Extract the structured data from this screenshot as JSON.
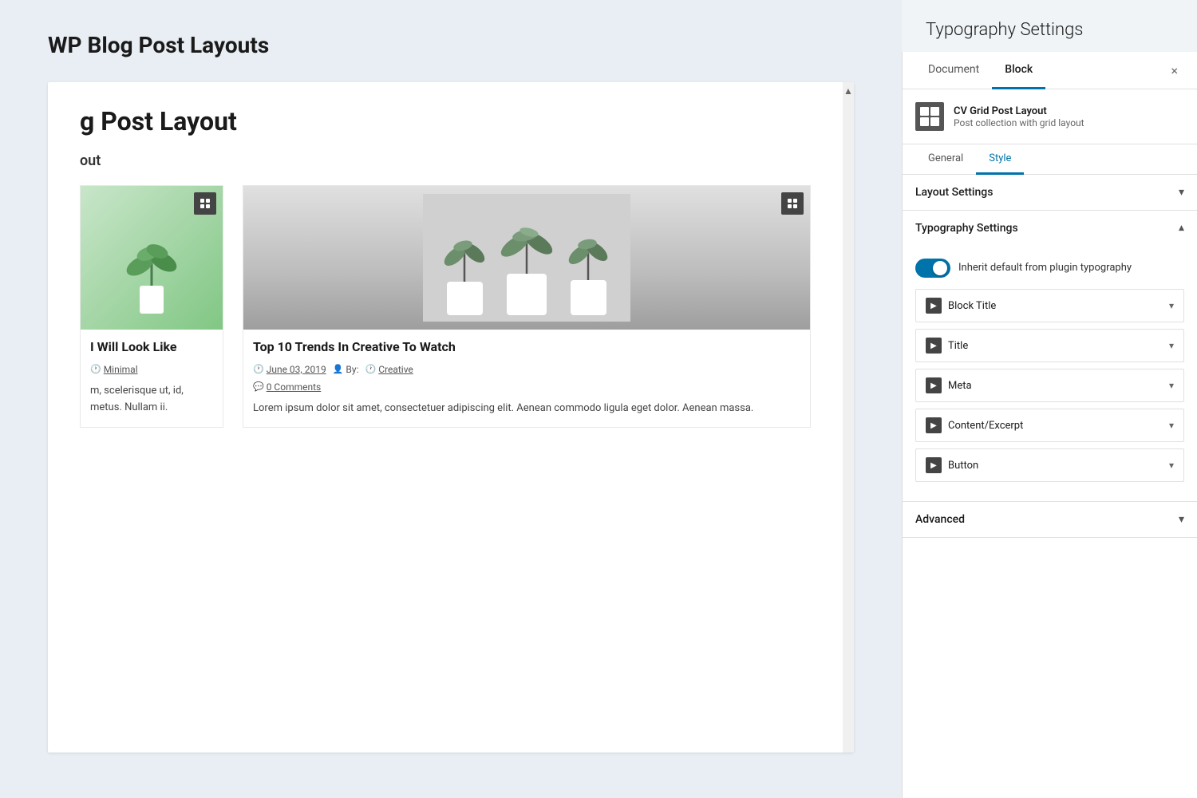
{
  "page": {
    "title": "WP Blog Post Layouts",
    "background_color": "#e8eef3"
  },
  "canvas": {
    "heading_partial": "g Post Layout",
    "sub_heading_partial": "out",
    "posts": [
      {
        "id": "post-1",
        "title_partial": "I Will Look Like",
        "meta": {
          "category": "Minimal",
          "show_clock": true
        },
        "excerpt_partial": "m, scelerisque ut, id, metus. Nullam ii.",
        "has_image": true,
        "image_type": "plant-single"
      },
      {
        "id": "post-2",
        "title": "Top 10 Trends In Creative To Watch",
        "meta": {
          "date": "June 03, 2019",
          "author": "By:",
          "category": "Creative",
          "comments": "0 Comments"
        },
        "excerpt": "Lorem ipsum dolor sit amet, consectetuer adipiscing elit. Aenean commodo ligula eget dolor. Aenean massa.",
        "has_image": true,
        "image_type": "plants-three"
      }
    ]
  },
  "right_panel": {
    "title": "Typography Settings",
    "tabs": {
      "document_label": "Document",
      "block_label": "Block",
      "active": "block",
      "close_label": "×"
    },
    "block_info": {
      "name": "CV Grid Post Layout",
      "description": "Post collection with grid layout"
    },
    "sub_tabs": {
      "general_label": "General",
      "style_label": "Style",
      "active": "style"
    },
    "accordions": [
      {
        "id": "layout-settings",
        "label": "Layout Settings",
        "expanded": false
      },
      {
        "id": "typography-settings",
        "label": "Typography Settings",
        "expanded": true,
        "toggle": {
          "label": "Inherit default from plugin typography",
          "enabled": true
        },
        "sub_items": [
          {
            "id": "block-title",
            "label": "Block Title"
          },
          {
            "id": "title",
            "label": "Title"
          },
          {
            "id": "meta",
            "label": "Meta"
          },
          {
            "id": "content-excerpt",
            "label": "Content/Excerpt"
          },
          {
            "id": "button",
            "label": "Button"
          }
        ]
      },
      {
        "id": "advanced",
        "label": "Advanced",
        "expanded": false
      }
    ],
    "icons": {
      "chevron_down": "▾",
      "chevron_up": "▴",
      "sub_arrow": "▶",
      "close": "×"
    }
  }
}
